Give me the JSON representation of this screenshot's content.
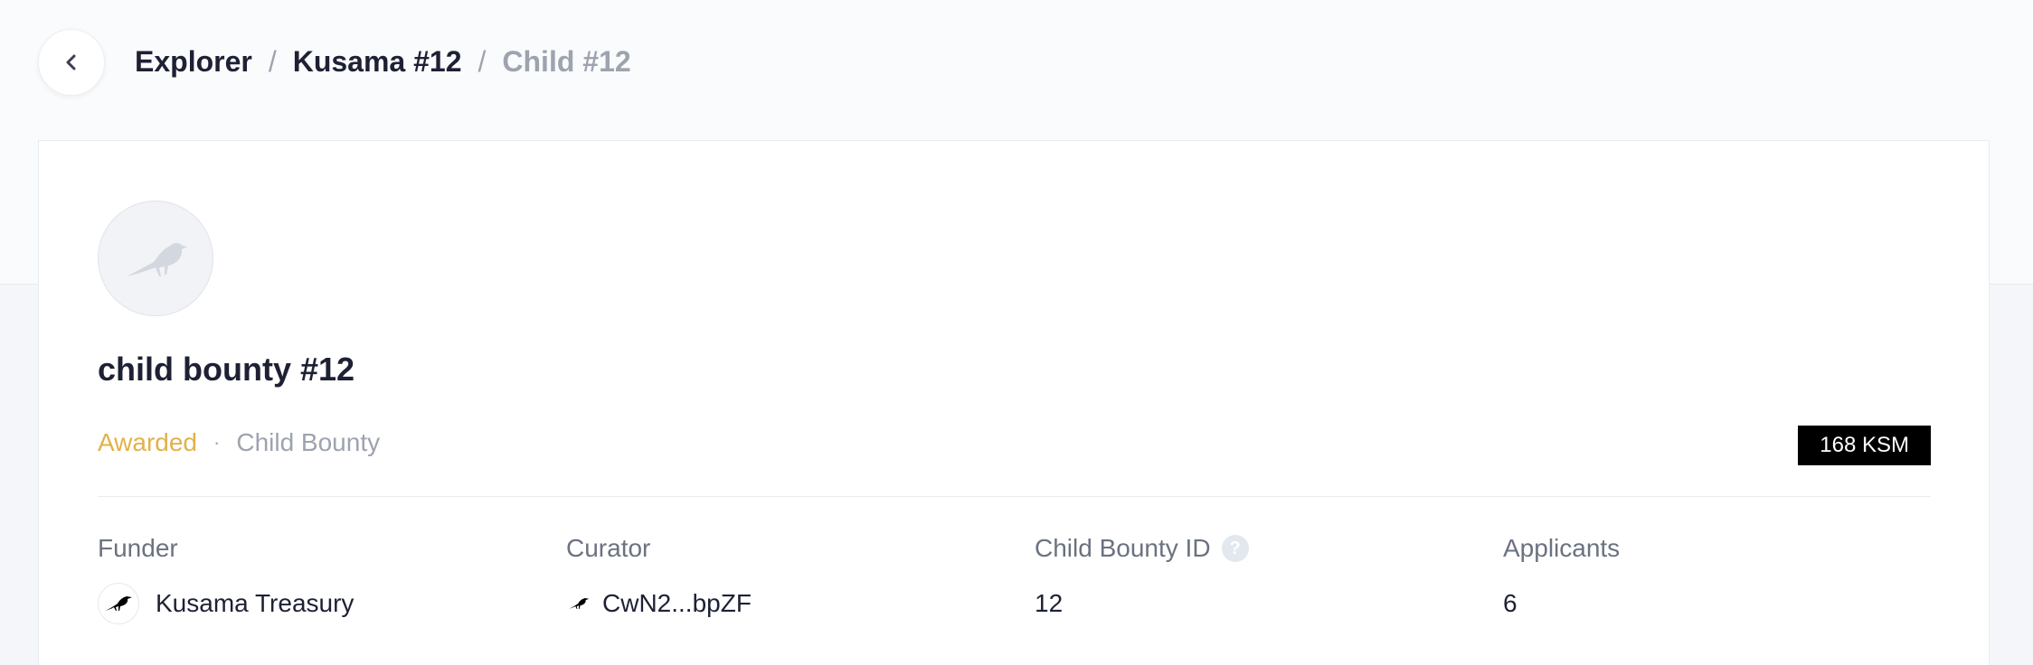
{
  "breadcrumb": {
    "items": [
      "Explorer",
      "Kusama #12"
    ],
    "current": "Child #12",
    "separator": "/"
  },
  "back": {
    "icon": "chevron-left-icon"
  },
  "bounty": {
    "avatar_icon": "bird-icon",
    "title": "child bounty #12",
    "status": "Awarded",
    "status_color": "#e2b14a",
    "separator": "·",
    "type": "Child Bounty",
    "value": "168 KSM"
  },
  "info": {
    "funder": {
      "label": "Funder",
      "value": "Kusama Treasury",
      "icon": "kusama-icon"
    },
    "curator": {
      "label": "Curator",
      "value": "CwN2...bpZF",
      "icon": "kusama-icon"
    },
    "child_bounty_id": {
      "label": "Child Bounty ID",
      "value": "12",
      "help_icon": "question-icon",
      "help_glyph": "?"
    },
    "applicants": {
      "label": "Applicants",
      "value": "6"
    }
  }
}
